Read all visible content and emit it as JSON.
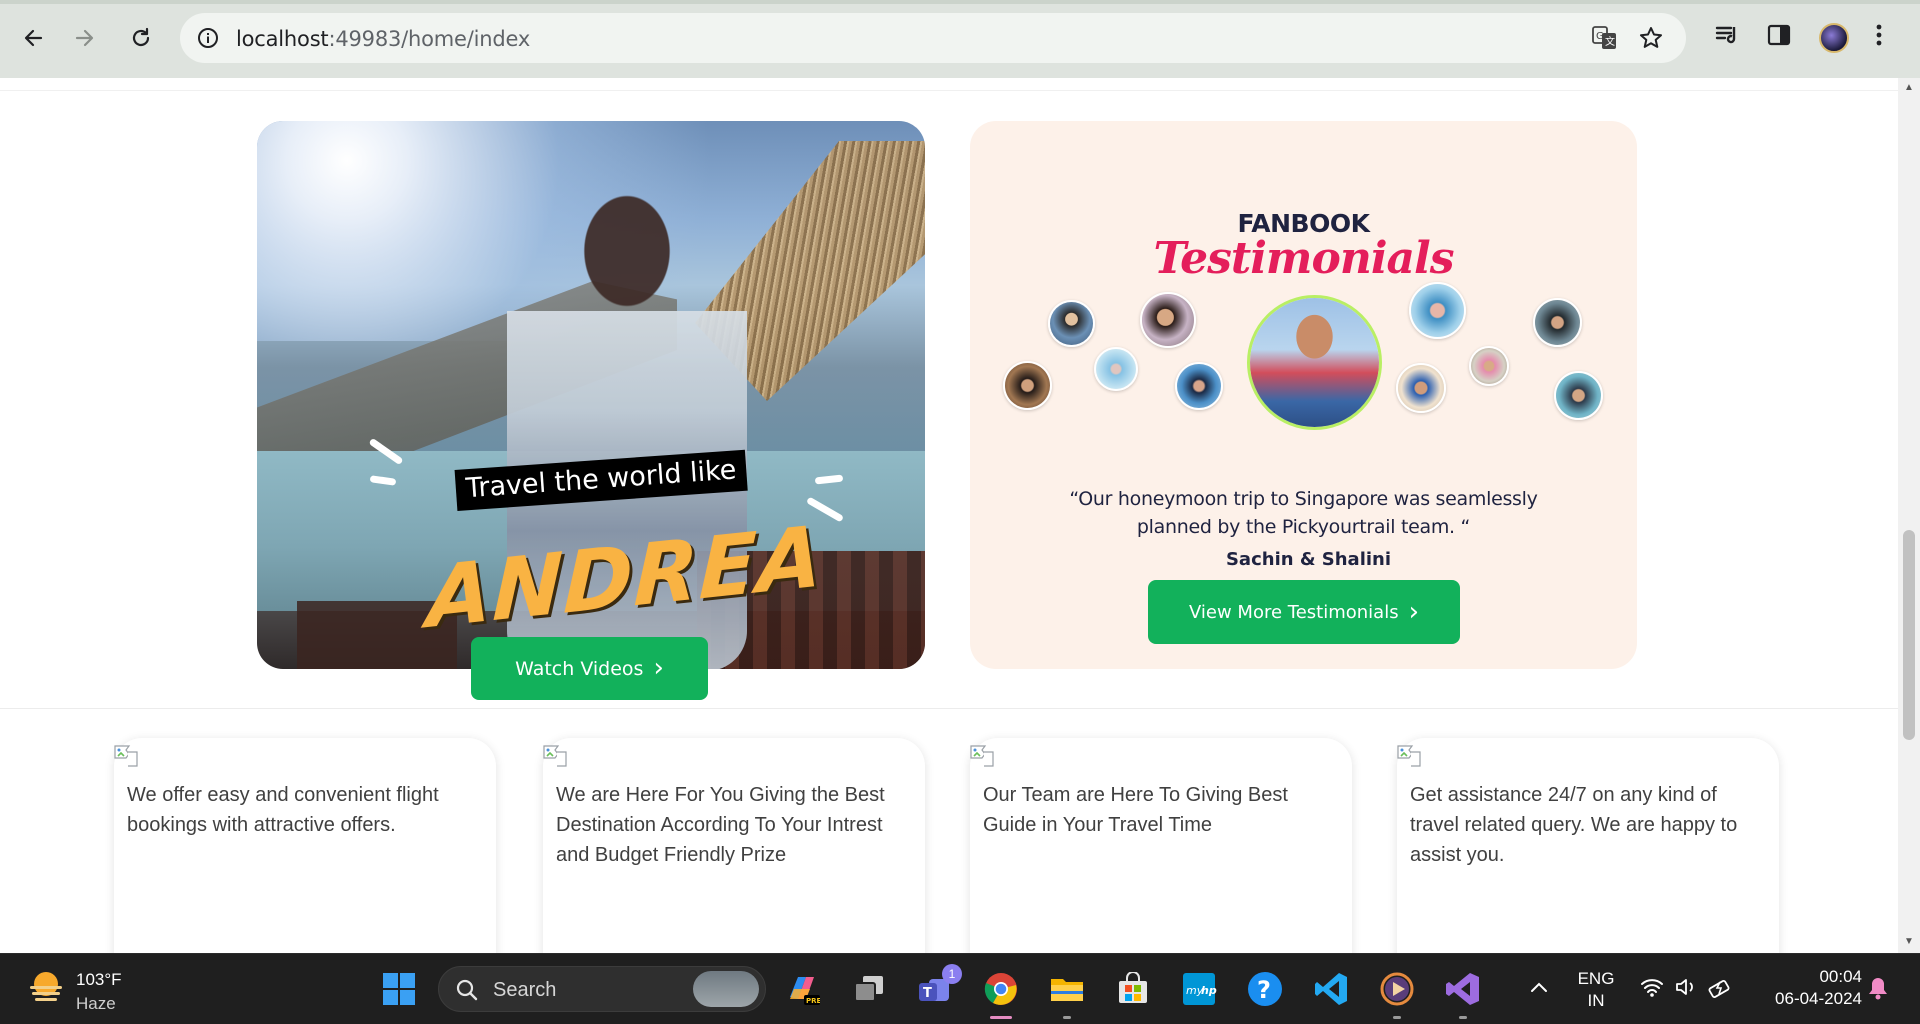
{
  "browser": {
    "url_host": "localhost",
    "url_rest": ":49983/home/index"
  },
  "video_card": {
    "line1": "Travel the world like",
    "line2": "ANDREA",
    "button_label": "Watch Videos",
    "button_chevron": "›"
  },
  "testimonials": {
    "heading": "FANBOOK",
    "script": "Testimonials",
    "quote": "“Our honeymoon trip to Singapore was seamlessly planned by the Pickyourtrail team. “",
    "author": "Sachin & Shalini",
    "button_label": "View More Testimonials",
    "button_chevron": "›"
  },
  "features": [
    {
      "text": "We offer easy and convenient flight bookings with attractive offers."
    },
    {
      "text": "We are Here For You Giving the Best Destination According To Your Intrest and Budget Friendly Prize"
    },
    {
      "text": "Our Team are Here To Giving Best Guide in Your Travel Time"
    },
    {
      "text": "Get assistance 24/7 on any kind of travel related query. We are happy to assist you."
    }
  ],
  "taskbar": {
    "weather_temp": "103°F",
    "weather_cond": "Haze",
    "search_label": "Search",
    "teams_badge": "1",
    "lang_line1": "ENG",
    "lang_line2": "IN",
    "time": "00:04",
    "date": "06-04-2024"
  },
  "colors": {
    "accent_green": "#12b15b",
    "testimonial_bg": "#fdf1e9",
    "script_pink": "#e41e5b",
    "andrea_yellow": "#f9b343"
  }
}
